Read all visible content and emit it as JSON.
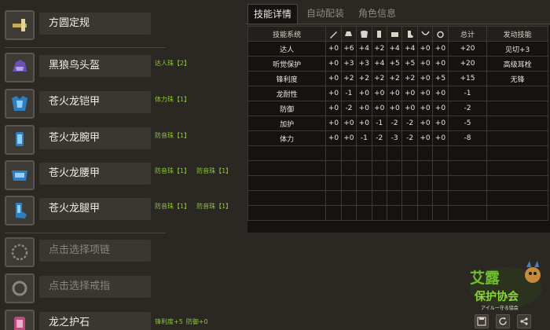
{
  "equipment": [
    {
      "name": "方圆定规",
      "icon": "weapon-icon",
      "jewels": [],
      "empty": false
    },
    {
      "name": "黑狼鸟头盔",
      "icon": "helmet-icon",
      "jewels": [
        "达人珠【2】"
      ],
      "empty": false
    },
    {
      "name": "苍火龙铠甲",
      "icon": "chest-armor-icon",
      "jewels": [
        "体力珠【1】"
      ],
      "empty": false
    },
    {
      "name": "苍火龙腕甲",
      "icon": "gauntlet-icon",
      "jewels": [
        "防音珠【1】"
      ],
      "empty": false
    },
    {
      "name": "苍火龙腰甲",
      "icon": "waist-armor-icon",
      "jewels": [
        "防音珠【1】",
        "防音珠【1】"
      ],
      "empty": false
    },
    {
      "name": "苍火龙腿甲",
      "icon": "leg-armor-icon",
      "jewels": [
        "防音珠【1】",
        "防音珠【1】"
      ],
      "empty": false
    },
    {
      "name": "点击选择项链",
      "icon": "necklace-icon",
      "jewels": [],
      "empty": true
    },
    {
      "name": "点击选择戒指",
      "icon": "ring-icon",
      "jewels": [],
      "empty": true
    },
    {
      "name": "龙之护石",
      "icon": "talisman-icon",
      "jewels": [
        "锋利度+5",
        "防御+0"
      ],
      "empty": false
    }
  ],
  "tabs": {
    "skill_details": "技能详情",
    "auto_equip": "自动配装",
    "char_info": "角色信息"
  },
  "table": {
    "header_name": "技能系统",
    "header_total": "总计",
    "header_skill": "发动技能",
    "column_icons": [
      "weapon-icon",
      "helmet-icon",
      "chest-armor-icon",
      "gauntlet-icon",
      "waist-armor-icon",
      "leg-armor-icon",
      "necklace-icon",
      "ring-icon"
    ],
    "rows": [
      {
        "name": "达人",
        "values": [
          "+0",
          "+6",
          "+4",
          "+2",
          "+4",
          "+4",
          "+0",
          "+0"
        ],
        "total": "+20",
        "skill": "见切+3"
      },
      {
        "name": "听觉保护",
        "values": [
          "+0",
          "+3",
          "+3",
          "+4",
          "+5",
          "+5",
          "+0",
          "+0"
        ],
        "total": "+20",
        "skill": "高级耳栓"
      },
      {
        "name": "锋利度",
        "values": [
          "+0",
          "+2",
          "+2",
          "+2",
          "+2",
          "+2",
          "+0",
          "+5"
        ],
        "total": "+15",
        "skill": "无锋"
      },
      {
        "name": "龙耐性",
        "values": [
          "+0",
          "-1",
          "+0",
          "+0",
          "+0",
          "+0",
          "+0",
          "+0"
        ],
        "total": "-1",
        "skill": ""
      },
      {
        "name": "防御",
        "values": [
          "+0",
          "-2",
          "+0",
          "+0",
          "+0",
          "+0",
          "+0",
          "+0"
        ],
        "total": "-2",
        "skill": ""
      },
      {
        "name": "加护",
        "values": [
          "+0",
          "+0",
          "+0",
          "-1",
          "-2",
          "-2",
          "+0",
          "+0"
        ],
        "total": "-5",
        "skill": ""
      },
      {
        "name": "体力",
        "values": [
          "+0",
          "+0",
          "-1",
          "-2",
          "-3",
          "-2",
          "+0",
          "+0"
        ],
        "total": "-8",
        "skill": ""
      }
    ]
  },
  "logo": {
    "line1": "艾露",
    "line2": "保护协会",
    "line3": "アイルー守る協会"
  },
  "footer_buttons": [
    "save-icon",
    "refresh-icon",
    "share-icon"
  ],
  "colors": {
    "accent_green": "#8fc63e",
    "panel_bg": "#141311",
    "slot_bg": "#3a3733"
  }
}
